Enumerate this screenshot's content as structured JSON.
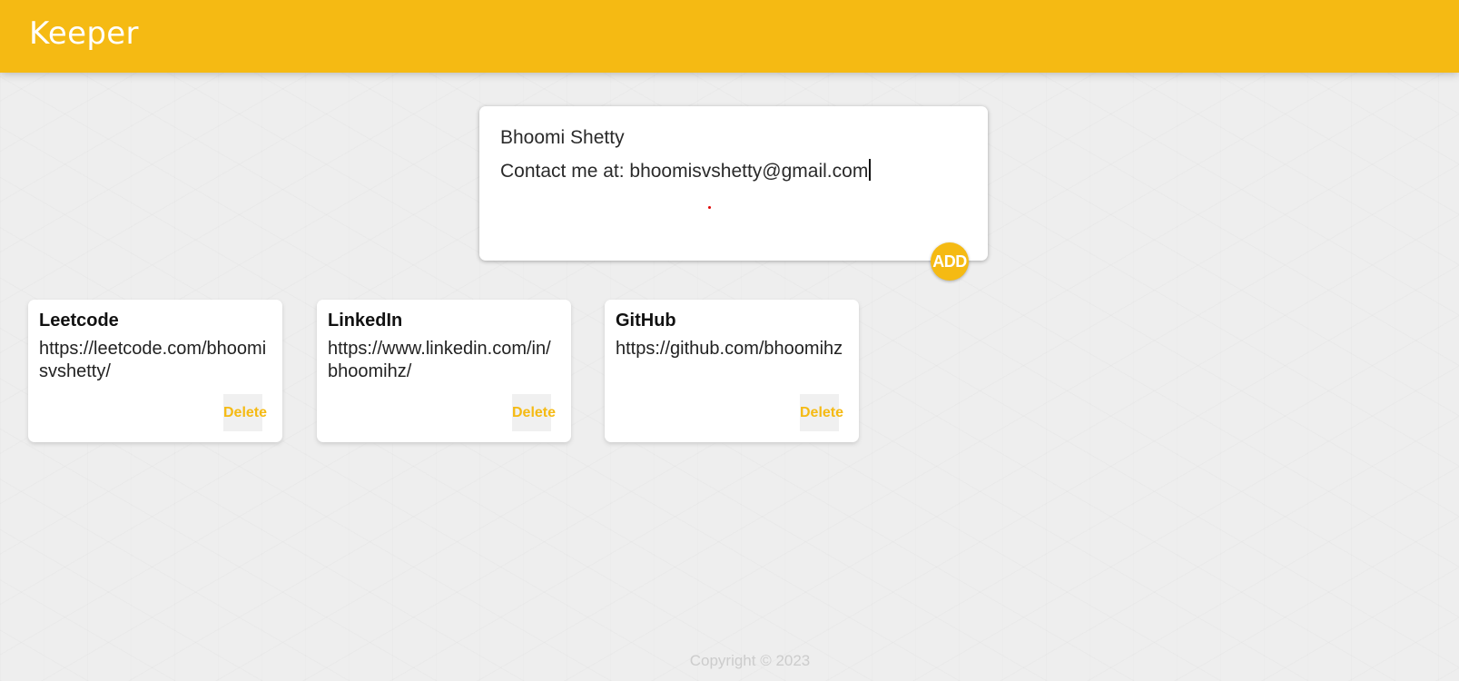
{
  "header": {
    "title": "Keeper"
  },
  "create_note": {
    "title_value": "Bhoomi Shetty",
    "content_value": "Contact me at: bhoomisvshetty@gmail.com",
    "add_label": "ADD"
  },
  "notes": [
    {
      "title": "Leetcode",
      "content": "https://leetcode.com/bhoomisvshetty/",
      "delete_label": "Delete"
    },
    {
      "title": "LinkedIn",
      "content": "https://www.linkedin.com/in/bhoomihz/",
      "delete_label": "Delete"
    },
    {
      "title": "GitHub",
      "content": "https://github.com/bhoomihz",
      "delete_label": "Delete"
    }
  ],
  "footer": {
    "text": "Copyright © 2023"
  },
  "colors": {
    "accent": "#f5ba13",
    "background": "#eeeeee",
    "card": "#ffffff",
    "footer_text": "#cccccc"
  }
}
